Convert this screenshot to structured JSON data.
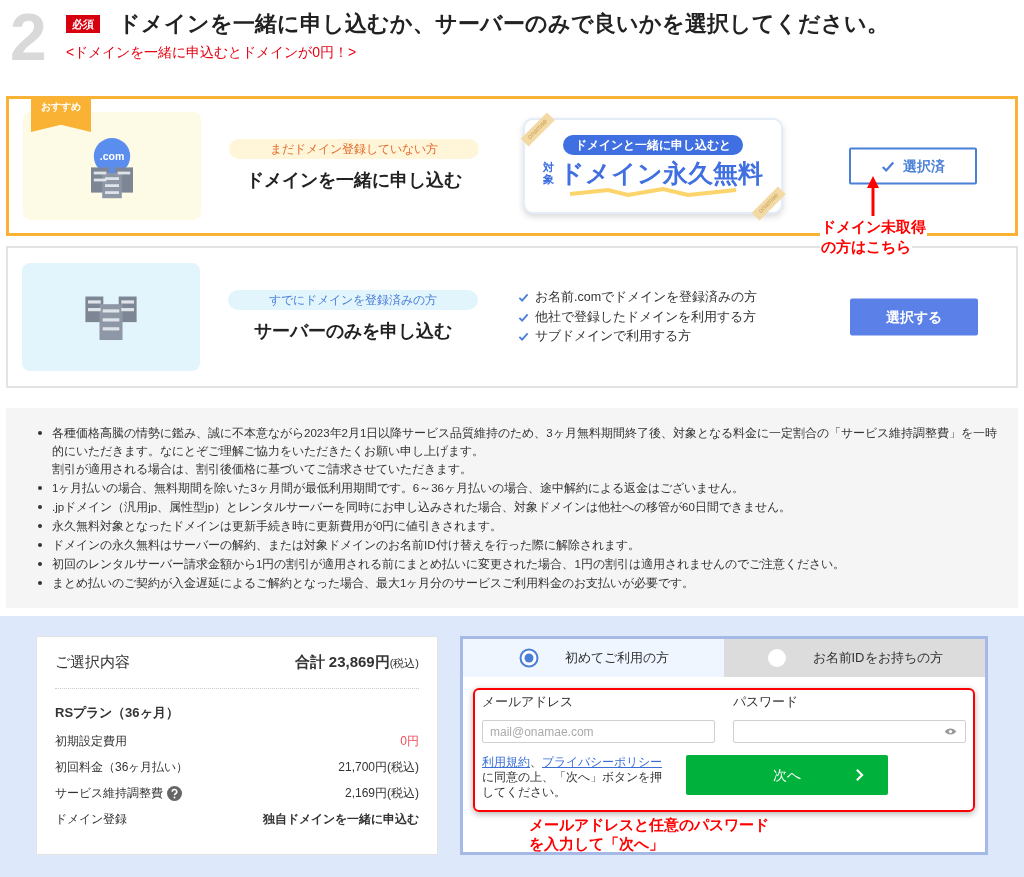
{
  "step": {
    "number": "2",
    "required_badge": "必須",
    "title": "ドメインを一緒に申し込むか、サーバーのみで良いかを選択してください。",
    "subtitle": "<ドメインを一緒に申込むとドメインが0円！>"
  },
  "options": [
    {
      "kind": "with_domain",
      "selected": true,
      "recommended_badge": "おすすめ",
      "illustration_label": ".com",
      "tag": "まだドメイン登録していない方",
      "title": "ドメインを一緒に申し込む",
      "banner": {
        "pill": "ドメインと一緒に申し込むと",
        "prefix": "対象",
        "headline": "ドメイン永久無料",
        "corner_labels": [
          "onamae",
          "onamae"
        ]
      },
      "button": "選択済"
    },
    {
      "kind": "server_only",
      "selected": false,
      "tag": "すでにドメインを登録済みの方",
      "title": "サーバーのみを申し込む",
      "checklist": [
        "お名前.comでドメインを登録済みの方",
        "他社で登録したドメインを利用する方",
        "サブドメインで利用する方"
      ],
      "button": "選択する"
    }
  ],
  "annotation_top": [
    "ドメイン未取得",
    "の方はこちら"
  ],
  "notes": [
    [
      "各種価格高騰の情勢に鑑み、誠に不本意ながら2023年2月1日以降サービス品質維持のため、3ヶ月無料期間終了後、対象となる料金に一定割合の「サービス維持調整費」を一時的にいただきます。なにとぞご理解ご協力をいただきたくお願い申し上げます。",
      "割引が適用される場合は、割引後価格に基づいてご請求させていただきます。"
    ],
    "1ヶ月払いの場合、無料期間を除いた3ヶ月間が最低利用期間です。6～36ヶ月払いの場合、途中解約による返金はございません。",
    ".jpドメイン（汎用jp、属性型jp）とレンタルサーバーを同時にお申し込みされた場合、対象ドメインは他社への移管が60日間できません。",
    "永久無料対象となったドメインは更新手続き時に更新費用が0円に値引きされます。",
    "ドメインの永久無料はサーバーの解約、または対象ドメインのお名前ID付け替えを行った際に解除されます。",
    "初回のレンタルサーバー請求金額から1円の割引が適用される前にまとめ払いに変更された場合、1円の割引は適用されませんのでご注意ください。",
    "まとめ払いのご契約が入金遅延によるご解約となった場合、最大1ヶ月分のサービスご利用料金のお支払いが必要です。"
  ],
  "summary": {
    "heading": "ご選択内容",
    "total": "合計 23,869円",
    "total_suffix": "(税込)",
    "plan": "RSプラン（36ヶ月）",
    "rows": [
      {
        "kind": "free",
        "label": "初期設定費用",
        "value": "0円",
        "help": false
      },
      {
        "kind": "price",
        "label": "初回料金（36ヶ月払い）",
        "value": "21,700円(税込)",
        "help": false
      },
      {
        "kind": "price",
        "label": "サービス維持調整費",
        "value": "2,169円(税込)",
        "help": true
      },
      {
        "kind": "bold",
        "label": "ドメイン登録",
        "value": "独自ドメインを一緒に申込む",
        "help": false
      }
    ]
  },
  "login": {
    "tabs": [
      {
        "label": "初めてご利用の方",
        "selected": true
      },
      {
        "label": "お名前IDをお持ちの方",
        "selected": false
      }
    ],
    "email": {
      "label": "メールアドレス",
      "placeholder": "mail@onamae.com"
    },
    "password": {
      "label": "パスワード"
    },
    "consent": {
      "links": [
        "利用規約",
        "プライバシーポリシー"
      ],
      "separator": "、",
      "text": "に同意の上、「次へ」ボタンを押してください。"
    },
    "next_button": "次へ"
  },
  "annotation_bottom": [
    "メールアドレスと任意のパスワード",
    "を入力して「次へ」"
  ]
}
